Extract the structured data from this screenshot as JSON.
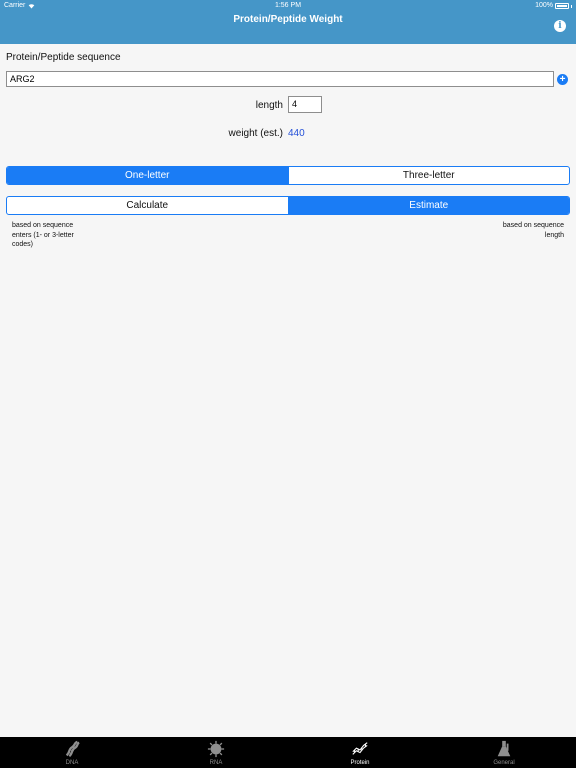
{
  "status_bar": {
    "carrier": "Carrier",
    "time": "1:56 PM",
    "battery": "100%"
  },
  "nav": {
    "title": "Protein/Peptide Weight",
    "info_icon": "info-icon"
  },
  "form": {
    "sequence_label": "Protein/Peptide sequence",
    "sequence_value": "ARG2",
    "add_icon": "plus-circle-icon",
    "length_label": "length",
    "length_value": "4",
    "weight_label": "weight (est.)",
    "weight_value": "440",
    "weight_color": "#2450d8"
  },
  "code_segment": {
    "options": [
      "One-letter",
      "Three-letter"
    ],
    "selected": "One-letter"
  },
  "mode_segment": {
    "options": [
      "Calculate",
      "Estimate"
    ],
    "selected": "Estimate"
  },
  "hints": {
    "left": "based on sequence enters (1- or 3-letter codes)",
    "right": "based on sequence length"
  },
  "tabs": [
    {
      "label": "DNA",
      "icon": "dna-icon",
      "active": false
    },
    {
      "label": "RNA",
      "icon": "rna-virus-icon",
      "active": false
    },
    {
      "label": "Protein",
      "icon": "protein-chain-icon",
      "active": true
    },
    {
      "label": "General",
      "icon": "flask-icon",
      "active": false
    }
  ],
  "colors": {
    "header": "#4596c8",
    "accent": "#1a7cf5",
    "tabbar": "#000000"
  }
}
